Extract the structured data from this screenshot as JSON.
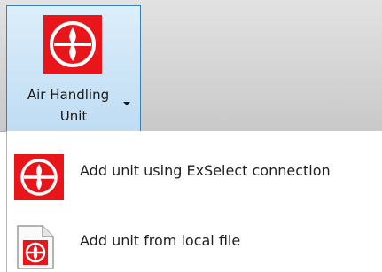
{
  "ribbon": {
    "split_button": {
      "label_line1": "Air Handling",
      "label_line2": "Unit",
      "icon": "air-handling-unit-icon"
    }
  },
  "menu": {
    "items": [
      {
        "label": "Add unit using ExSelect connection",
        "icon": "air-handling-unit-icon"
      },
      {
        "label": "Add unit from local file",
        "icon": "local-file-icon"
      }
    ]
  },
  "colors": {
    "icon_red": "#e8161b",
    "highlight_border": "#3c7fb1",
    "highlight_fill": "#cfe6f8"
  }
}
